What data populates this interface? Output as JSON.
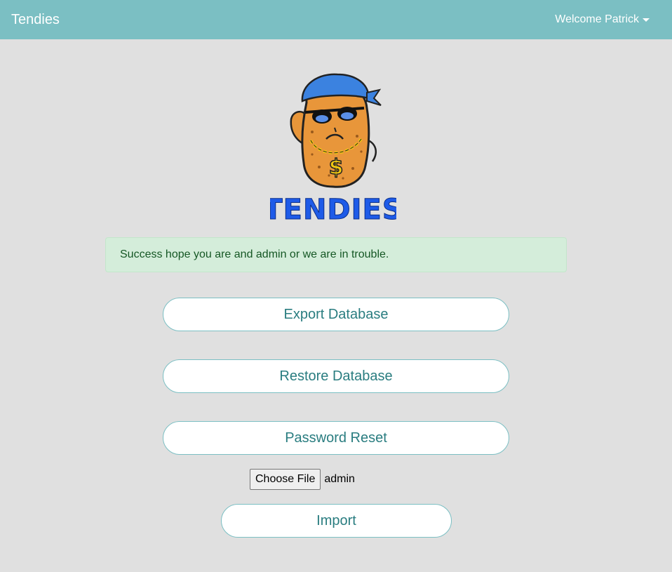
{
  "navbar": {
    "brand": "Tendies",
    "user_menu_label": "Welcome Patrick"
  },
  "logo": {
    "wordmark": "TENDIES",
    "icon": "tendie-mascot-logo",
    "colors": {
      "bandana": "#3b82e0",
      "nugget": "#e8963a",
      "chain": "#f2c811",
      "wordmark": "#1e5be8"
    }
  },
  "alert": {
    "message": "Success hope you are and admin or we are in trouble."
  },
  "actions": {
    "export_label": "Export Database",
    "restore_label": "Restore Database",
    "reset_label": "Password Reset"
  },
  "file_input": {
    "button_label": "Choose File",
    "file_name": "admin"
  },
  "import": {
    "label": "Import"
  },
  "colors": {
    "navbar": "#7bbfc3",
    "background": "#e0e0e0",
    "button_text": "#2a7d80",
    "alert_bg": "#d4edda",
    "alert_text": "#155724"
  }
}
